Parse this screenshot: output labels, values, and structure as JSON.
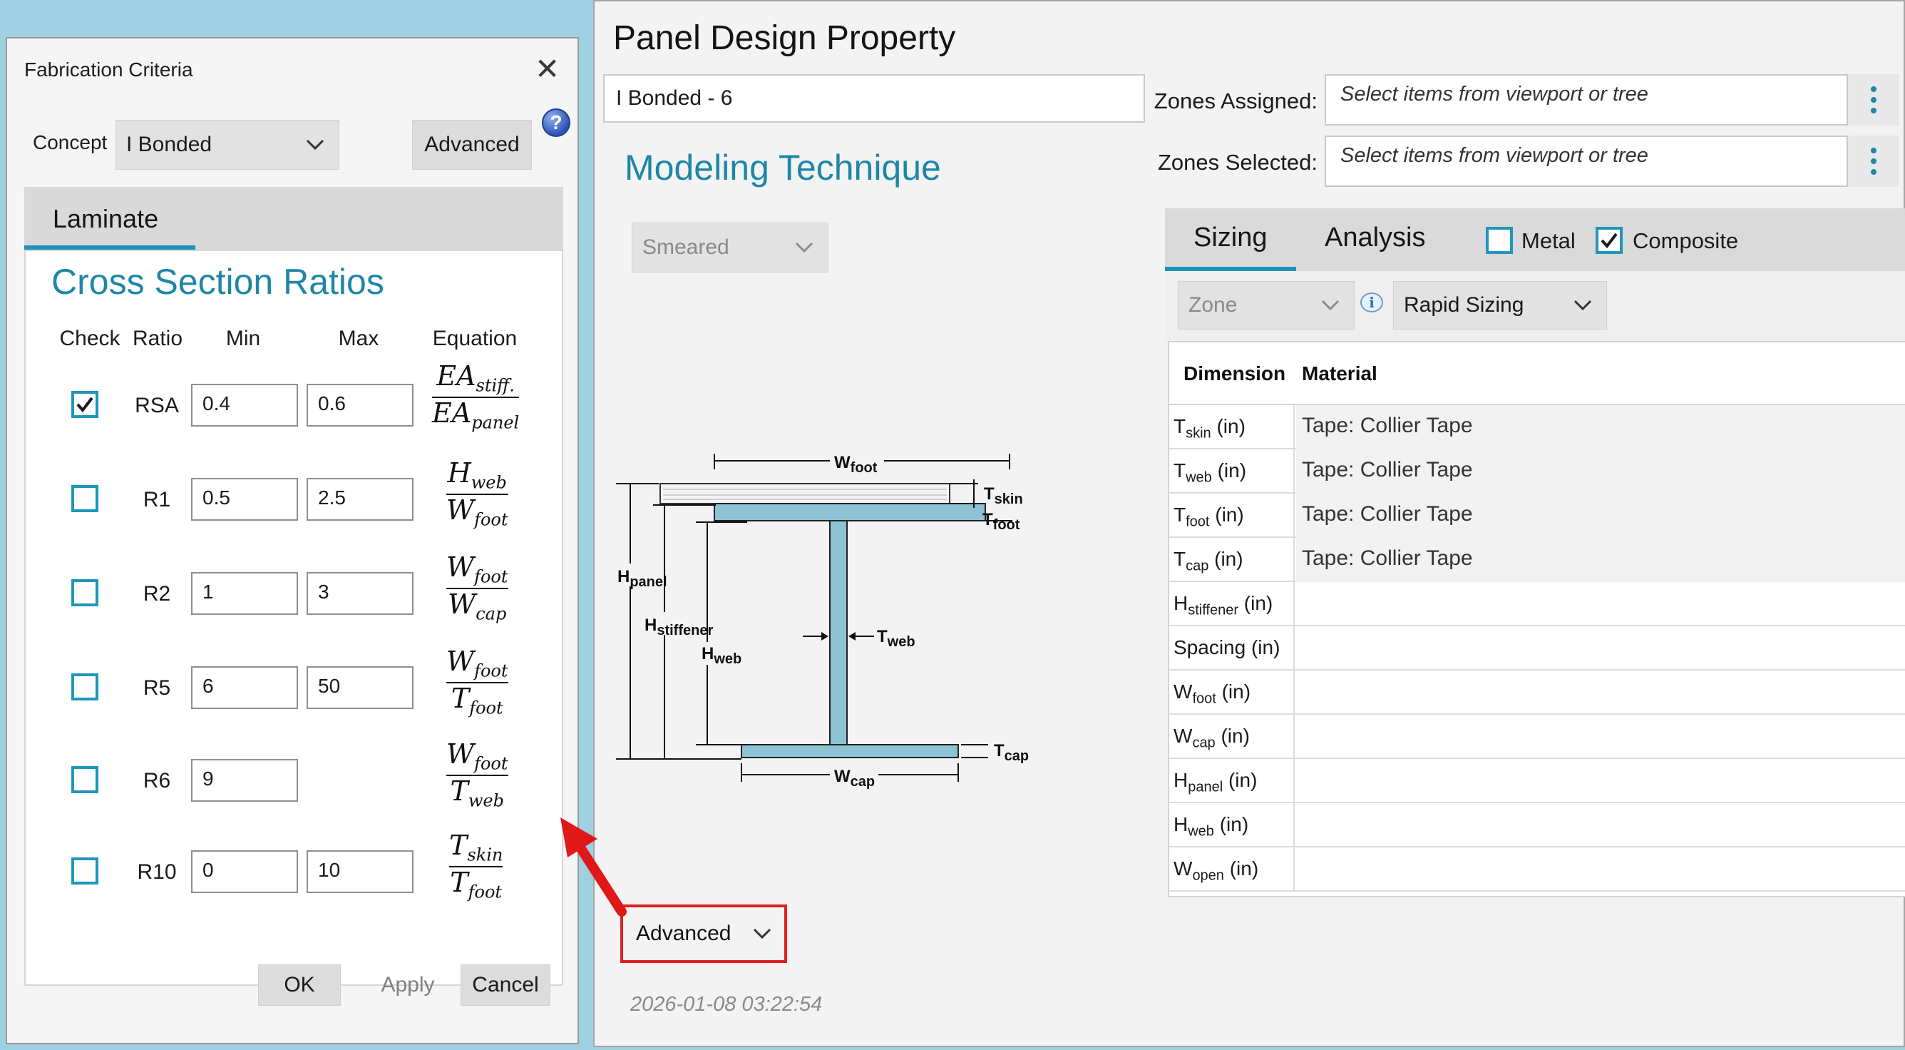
{
  "fab_dialog": {
    "title": "Fabrication Criteria",
    "concept_label": "Concept",
    "concept_value": "I Bonded",
    "advanced_button": "Advanced",
    "tab_laminate": "Laminate",
    "section_title": "Cross Section Ratios",
    "columns": {
      "check": "Check",
      "ratio": "Ratio",
      "min": "Min",
      "max": "Max",
      "equation": "Equation"
    },
    "rows": [
      {
        "name": "RSA",
        "checked": true,
        "min": "0.4",
        "max": "0.6"
      },
      {
        "name": "R1",
        "checked": false,
        "min": "0.5",
        "max": "2.5"
      },
      {
        "name": "R2",
        "checked": false,
        "min": "1",
        "max": "3"
      },
      {
        "name": "R5",
        "checked": false,
        "min": "6",
        "max": "50"
      },
      {
        "name": "R6",
        "checked": false,
        "min": "9",
        "max": ""
      },
      {
        "name": "R10",
        "checked": false,
        "min": "0",
        "max": "10"
      }
    ],
    "equations": [
      {
        "num": "EA",
        "num_sub": "stiff.",
        "den": "EA",
        "den_sub": "panel"
      },
      {
        "num": "H",
        "num_sub": "web",
        "den": "W",
        "den_sub": "foot"
      },
      {
        "num": "W",
        "num_sub": "foot",
        "den": "W",
        "den_sub": "cap"
      },
      {
        "num": "W",
        "num_sub": "foot",
        "den": "T",
        "den_sub": "foot"
      },
      {
        "num": "W",
        "num_sub": "foot",
        "den": "T",
        "den_sub": "web"
      },
      {
        "num": "T",
        "num_sub": "skin",
        "den": "T",
        "den_sub": "foot"
      }
    ],
    "ok_button": "OK",
    "apply_button": "Apply",
    "cancel_button": "Cancel"
  },
  "main": {
    "title": "Panel Design Property",
    "name_value": "I Bonded - 6",
    "modeling_title": "Modeling Technique",
    "modeling_value": "Smeared",
    "zones_assigned_label": "Zones Assigned:",
    "zones_selected_label": "Zones Selected:",
    "zones_placeholder": "Select items from viewport or tree",
    "tab_sizing": "Sizing",
    "tab_analysis": "Analysis",
    "metal_label": "Metal",
    "metal_checked": false,
    "composite_label": "Composite",
    "composite_checked": true,
    "zone_dropdown": "Zone",
    "rapid_sizing": "Rapid Sizing",
    "grid_headers": {
      "dimension": "Dimension",
      "material": "Material"
    },
    "grid_rows": [
      {
        "dim": "T",
        "sub": "skin",
        "unit": " (in)",
        "material": "Tape: Collier Tape"
      },
      {
        "dim": "T",
        "sub": "web",
        "unit": " (in)",
        "material": "Tape: Collier Tape"
      },
      {
        "dim": "T",
        "sub": "foot",
        "unit": " (in)",
        "material": "Tape: Collier Tape"
      },
      {
        "dim": "T",
        "sub": "cap",
        "unit": " (in)",
        "material": "Tape: Collier Tape"
      },
      {
        "dim": "H",
        "sub": "stiffener",
        "unit": " (in)",
        "material": ""
      },
      {
        "dim": "Spacing",
        "sub": "",
        "unit": " (in)",
        "material": ""
      },
      {
        "dim": "W",
        "sub": "foot",
        "unit": " (in)",
        "material": ""
      },
      {
        "dim": "W",
        "sub": "cap",
        "unit": " (in)",
        "material": ""
      },
      {
        "dim": "H",
        "sub": "panel",
        "unit": " (in)",
        "material": ""
      },
      {
        "dim": "H",
        "sub": "web",
        "unit": " (in)",
        "material": ""
      },
      {
        "dim": "W",
        "sub": "open",
        "unit": " (in)",
        "material": ""
      }
    ],
    "advanced_dropdown": "Advanced",
    "timestamp": "2026-01-08 03:22:54"
  },
  "diagram": {
    "labels": {
      "wfoot": "W",
      "wfoot_sub": "foot",
      "tskin": "T",
      "tskin_sub": "skin",
      "tfoot": "T",
      "tfoot_sub": "foot",
      "hpanel": "H",
      "hpanel_sub": "panel",
      "hstiffener": "H",
      "hstiffener_sub": "stiffener",
      "hweb": "H",
      "hweb_sub": "web",
      "tweb": "T",
      "tweb_sub": "web",
      "tcap": "T",
      "tcap_sub": "cap",
      "wcap": "W",
      "wcap_sub": "cap"
    }
  },
  "colors": {
    "accent": "#1e86a7",
    "highlight": "#e02020",
    "beam": "#8ec3d6"
  }
}
